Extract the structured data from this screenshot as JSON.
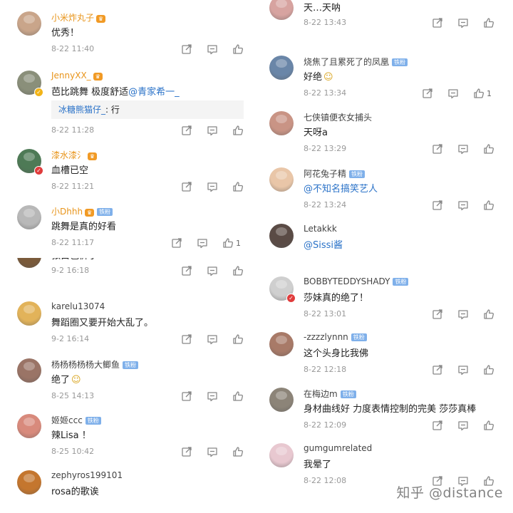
{
  "panels": [
    {
      "comments": [
        {
          "name": "小米炸丸子",
          "text": "优秀！",
          "time": "8-22 11:40",
          "name_style": "gold",
          "crown": true,
          "avatar": "#c9a58a"
        },
        {
          "name": "JennyXX_",
          "text": "芭比跳舞 极度舒适",
          "mention": "@青家希一_",
          "time": "8-22 11:28",
          "name_style": "gold",
          "crown": true,
          "avatar": "#8a8f7a",
          "verified": "#f2b418",
          "reply": {
            "name": "冰糖熊猫仔_",
            "text": ": 行"
          }
        },
        {
          "name": "漆水漆氵",
          "text": "血槽已空",
          "time": "8-22 11:21",
          "name_style": "gold",
          "crown": true,
          "avatar": "#4e7a56",
          "verified": "#e03c3c"
        },
        {
          "name": "小Dhhh",
          "text": "跳舞是真的好看",
          "time": "8-22 11:17",
          "name_style": "gold",
          "crown": true,
          "iron": "铁粉",
          "avatar": "#b8b8b8",
          "likes": "1"
        }
      ]
    },
    {
      "comments": [
        {
          "name": "",
          "text": "天…天呐",
          "time": "8-22 13:43",
          "avatar": "#d7a3a0",
          "cut_top": true
        },
        {
          "name": "烧焦了且累死了的凤凰",
          "text": "好绝",
          "emoji": true,
          "time": "8-22 13:34",
          "name_style": "plain",
          "iron": "铁粉",
          "avatar": "#6a86a8",
          "likes": "1"
        },
        {
          "name": "七侠镇便衣女捕头",
          "text": "天呀a",
          "time": "8-22 13:29",
          "name_style": "plain",
          "avatar": "#c99485"
        },
        {
          "name": "阿花兔子精",
          "text": "",
          "mention": "@不知名搞笑艺人",
          "time": "8-22 13:24",
          "name_style": "plain",
          "iron": "铁粉",
          "avatar": "#e9c6a8"
        },
        {
          "name": "Letakkk",
          "text": "",
          "mention": "@Sissi酱",
          "time": "",
          "name_style": "plain",
          "avatar": "#5a4b45"
        }
      ]
    },
    {
      "comments": [
        {
          "name": "",
          "text": "张白色裤子",
          "time": "9-2 16:18",
          "avatar": "#7a5a3a",
          "cut_top": true
        },
        {
          "name": "karelu13074",
          "text": "舞蹈圈又要开始大乱了。",
          "time": "9-2 16:14",
          "name_style": "plain",
          "avatar": "#e2b35a"
        },
        {
          "name": "杨杨杨杨杨大鲫鱼",
          "text": "绝了",
          "emoji": true,
          "time": "8-25 14:13",
          "name_style": "plain",
          "iron": "铁粉",
          "avatar": "#9a7466"
        },
        {
          "name": "姬姬ccc",
          "text": "辣Lisa ！",
          "time": "8-25 10:42",
          "name_style": "plain",
          "iron": "铁粉",
          "avatar": "#d88a7c"
        },
        {
          "name": "zephyros199101",
          "text": "rosa的歌诶",
          "time": "",
          "name_style": "plain",
          "avatar": "#c4762e"
        }
      ]
    },
    {
      "comments": [
        {
          "name": "BOBBYTEDDYSHADY",
          "text": "莎妹真的绝了！",
          "time": "8-22 13:01",
          "name_style": "plain",
          "iron": "铁粉",
          "avatar": "#cfcfcf",
          "verified": "#e03c3c"
        },
        {
          "name": "-zzzzlynnn",
          "text": "这个头身比我佛",
          "time": "8-22 12:18",
          "name_style": "plain",
          "iron": "铁粉",
          "avatar": "#a87a68"
        },
        {
          "name": "在梅边m",
          "text": "身材曲线好 力度表情控制的完美 莎莎真棒",
          "time": "8-22 12:09",
          "name_style": "plain",
          "iron": "铁粉",
          "avatar": "#8c8478"
        },
        {
          "name": "gumgumrelated",
          "text": "我晕了",
          "time": "8-22 12:08",
          "name_style": "plain",
          "avatar": "#e8c8d0"
        }
      ]
    }
  ],
  "watermark": "知乎 @distance",
  "icons": {
    "share": "share-icon",
    "comment": "comment-icon",
    "like": "like-icon"
  }
}
